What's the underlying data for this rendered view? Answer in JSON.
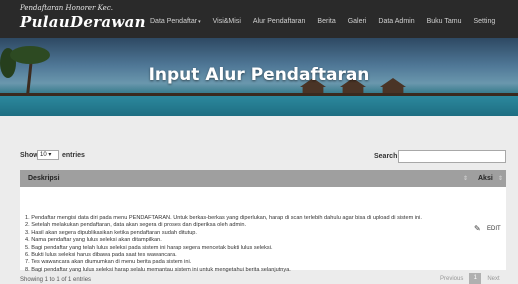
{
  "brand": {
    "small": "Pendaftaran Honorer Kec.",
    "big": "PulauDerawan"
  },
  "nav": {
    "items": [
      {
        "label": "Data Pendaftar",
        "caret": "▾"
      },
      {
        "label": "Visi&Misi"
      },
      {
        "label": "Alur Pendaftaran"
      },
      {
        "label": "Berita"
      },
      {
        "label": "Galeri"
      },
      {
        "label": "Data Admin"
      },
      {
        "label": "Buku Tamu"
      },
      {
        "label": "Setting"
      }
    ]
  },
  "hero": {
    "title": "Input Alur Pendaftaran"
  },
  "controls": {
    "show_label": "Show",
    "length_value": "10",
    "entries_label": "entries",
    "search_label": "Search:",
    "search_value": ""
  },
  "table": {
    "headers": {
      "desc": "Deskripsi",
      "aksi": "Aksi"
    },
    "rows": [
      {
        "lines": [
          "1. Pendaftar mengisi data diri pada menu PENDAFTARAN. Untuk berkas-berkas yang diperlukan, harap di scan terlebih dahulu agar bisa di upload di sistem ini.",
          "2. Setelah melakukan pendaftaran, data akan segera di proses dan diperiksa oleh admin.",
          "3. Hasil akan segera dipublikasikan ketika pendaftaran sudah ditutup.",
          "4. Nama pendaftar yang lulus seleksi akan ditampilkan.",
          "5. Bagi pendaftar yang telah lulus seleksi pada sistem ini harap segera mencetak bukti lulus seleksi.",
          "6. Bukti lulus seleksi harus dibawa pada saat tes wawancara.",
          "7. Tes wawancara akan diumumkan di menu berita pada sistem ini.",
          "8. Bagi pendaftar yang lulus seleksi harap selalu memantau sistem ini untuk mengetahui berita selanjutnya."
        ],
        "action_label": "EDIT"
      }
    ]
  },
  "footer": {
    "info": "Showing 1 to 1 of 1 entries",
    "prev": "Previous",
    "page": "1",
    "next": "Next"
  }
}
